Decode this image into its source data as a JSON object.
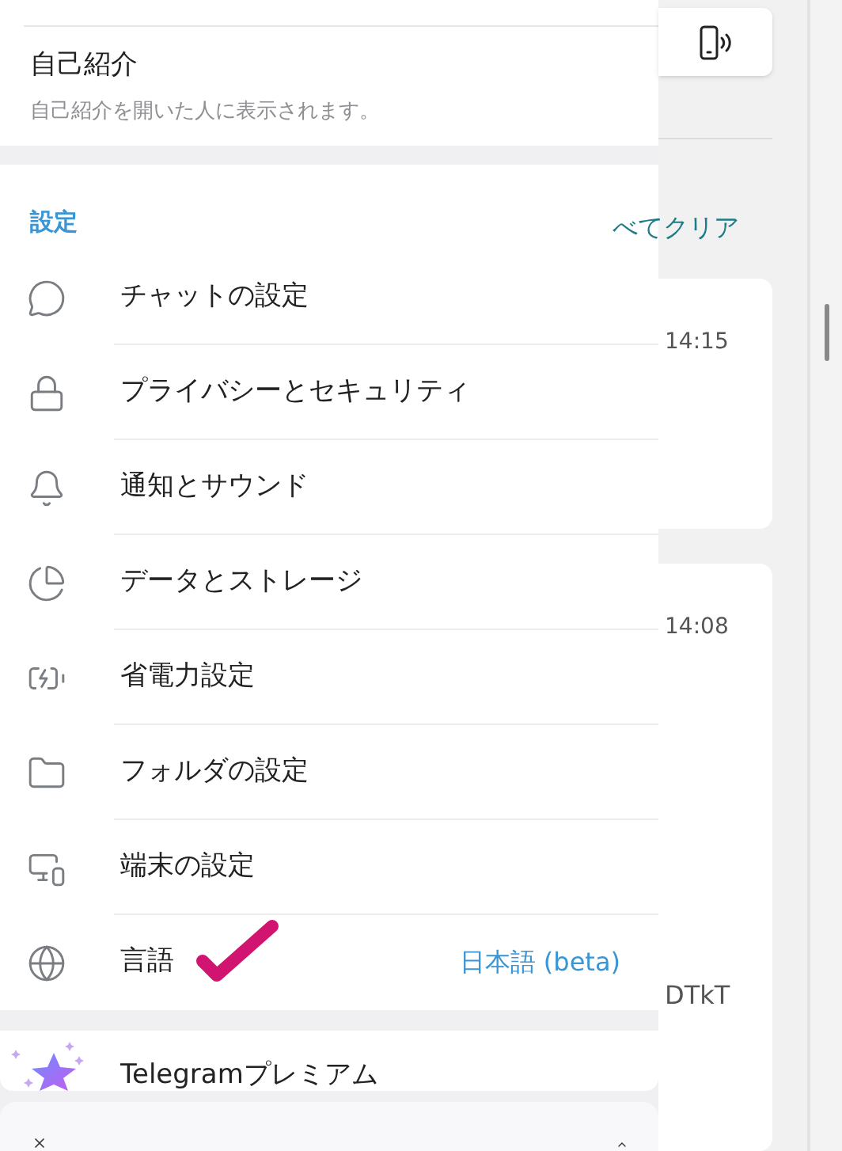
{
  "bio": {
    "title": "自己紹介",
    "hint": "自己紹介を開いた人に表示されます。"
  },
  "settings": {
    "heading": "設定",
    "items": [
      {
        "label": "チャットの設定"
      },
      {
        "label": "プライバシーとセキュリティ"
      },
      {
        "label": "通知とサウンド"
      },
      {
        "label": "データとストレージ"
      },
      {
        "label": "省電力設定"
      },
      {
        "label": "フォルダの設定"
      },
      {
        "label": "端末の設定"
      },
      {
        "label": "言語",
        "value": "日本語 (beta)"
      }
    ]
  },
  "premium": {
    "label": "Telegramプレミアム"
  },
  "background": {
    "clear_link": "べてクリア",
    "chats": [
      {
        "time": "14:15"
      },
      {
        "time": "14:08",
        "snippet": "DTkT"
      }
    ]
  }
}
